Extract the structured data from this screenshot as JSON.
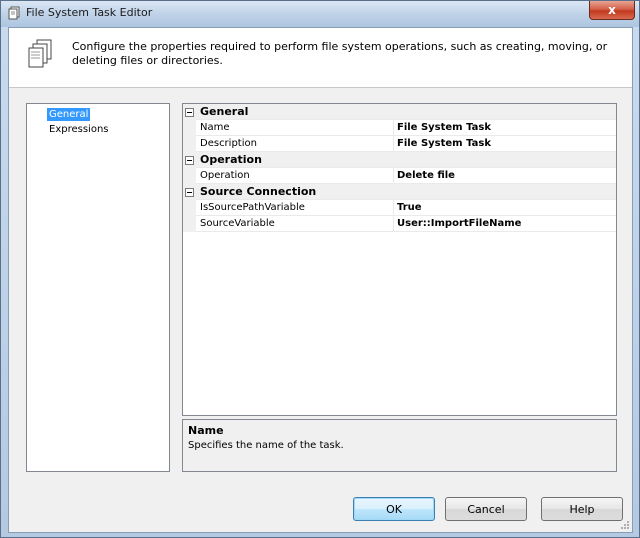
{
  "window": {
    "title": "File System Task Editor",
    "close_glyph": "x"
  },
  "header": {
    "icon": "file-documents-icon",
    "description": "Configure the properties required to perform file system operations, such as creating, moving, or deleting files or directories."
  },
  "nav": {
    "items": [
      {
        "label": "General",
        "selected": true
      },
      {
        "label": "Expressions",
        "selected": false
      }
    ]
  },
  "grid": {
    "categories": [
      {
        "label": "General",
        "properties": [
          {
            "name": "Name",
            "value": "File System Task"
          },
          {
            "name": "Description",
            "value": "File System Task"
          }
        ]
      },
      {
        "label": "Operation",
        "properties": [
          {
            "name": "Operation",
            "value": "Delete file"
          }
        ]
      },
      {
        "label": "Source Connection",
        "properties": [
          {
            "name": "IsSourcePathVariable",
            "value": "True"
          },
          {
            "name": "SourceVariable",
            "value": "User::ImportFileName"
          }
        ]
      }
    ]
  },
  "description_pane": {
    "title": "Name",
    "text": "Specifies the name of the task."
  },
  "buttons": {
    "ok": "OK",
    "cancel": "Cancel",
    "help": "Help"
  },
  "colors": {
    "selection": "#3399ff",
    "close_button": "#c2391f",
    "default_button_border": "#3c7fb1"
  }
}
